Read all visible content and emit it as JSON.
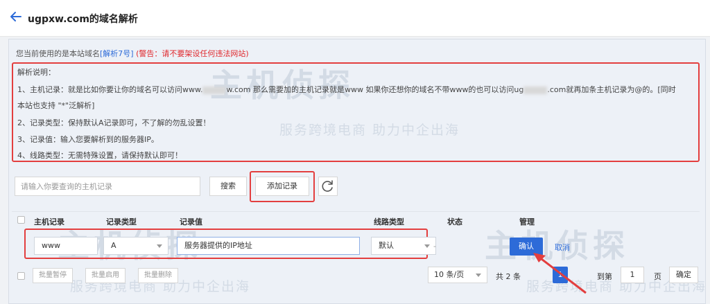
{
  "header": {
    "title": "ugpxw.com的域名解析"
  },
  "domain_info": {
    "prefix": "您当前使用的是本站域名",
    "link": "[解析7号]",
    "warning": "(警告：请不要架设任何违法网站)"
  },
  "notes": {
    "heading": "解析说明：",
    "line1_a": "1、主机记录：就是比如你要让你的域名可以访问www.",
    "line1_b": "w.com 那么需要加的主机记录就是www 如果你还想你的域名不带www的也可以访问ug",
    "line1_c": ".com就再加条主机记录为@的。[同时",
    "line1_cont": "本站也支持 \"*\"泛解析]",
    "line2": "2、记录类型：保持默认A记录即可，不了解的勿乱设置！",
    "line3": "3、记录值：输入您要解析到的服务器IP。",
    "line4": "4、线路类型：无需特殊设置，请保持默认即可！"
  },
  "search": {
    "placeholder": "请输入你要查询的主机记录",
    "button": "搜索",
    "add_button": "添加记录"
  },
  "table": {
    "headers": {
      "host": "主机记录",
      "type": "记录类型",
      "value": "记录值",
      "line": "线路类型",
      "status": "状态",
      "manage": "管理"
    },
    "edit_row": {
      "host": "www",
      "type": "A",
      "value": "服务器提供的IP地址",
      "line": "默认",
      "status": "-",
      "confirm": "确认",
      "cancel": "取消"
    }
  },
  "batch": {
    "pause": "批量暂停",
    "enable": "批量启用",
    "delete": "批量删除"
  },
  "pagination": {
    "page_size": "10 条/页",
    "total": "共 2 条",
    "current_page": "1",
    "goto_prefix": "到第",
    "goto_value": "1",
    "goto_suffix": "页",
    "confirm": "确定"
  },
  "watermark": {
    "brand": "主机侦探",
    "slogan": "服务跨境电商  助力中企出海"
  },
  "colors": {
    "primary": "#2d6bd8",
    "highlight": "#e33e3e",
    "warning": "#e0272c"
  }
}
